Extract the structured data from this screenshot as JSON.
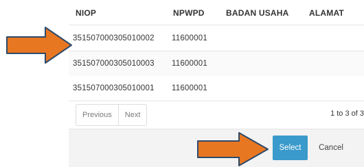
{
  "table": {
    "columns": [
      "NIOP",
      "NPWPD",
      "BADAN USAHA",
      "ALAMAT"
    ],
    "rows": [
      {
        "niop": "351507000305010002",
        "npwpd": "11600001",
        "badan_usaha": "",
        "alamat": ""
      },
      {
        "niop": "351507000305010003",
        "npwpd": "11600001",
        "badan_usaha": "",
        "alamat": ""
      },
      {
        "niop": "351507000305010001",
        "npwpd": "11600001",
        "badan_usaha": "",
        "alamat": ""
      }
    ]
  },
  "pagination": {
    "previous_label": "Previous",
    "next_label": "Next",
    "info": "1 to 3 of 3"
  },
  "footer": {
    "select_label": "Select",
    "cancel_label": "Cancel"
  },
  "colors": {
    "accent": "#3a9acb",
    "arrow": "#e87722",
    "arrow_outline": "#2d4a6b"
  },
  "annotations": [
    {
      "icon": "arrow-right-icon",
      "target": "first-row-niop"
    },
    {
      "icon": "arrow-right-icon",
      "target": "select-button"
    }
  ]
}
